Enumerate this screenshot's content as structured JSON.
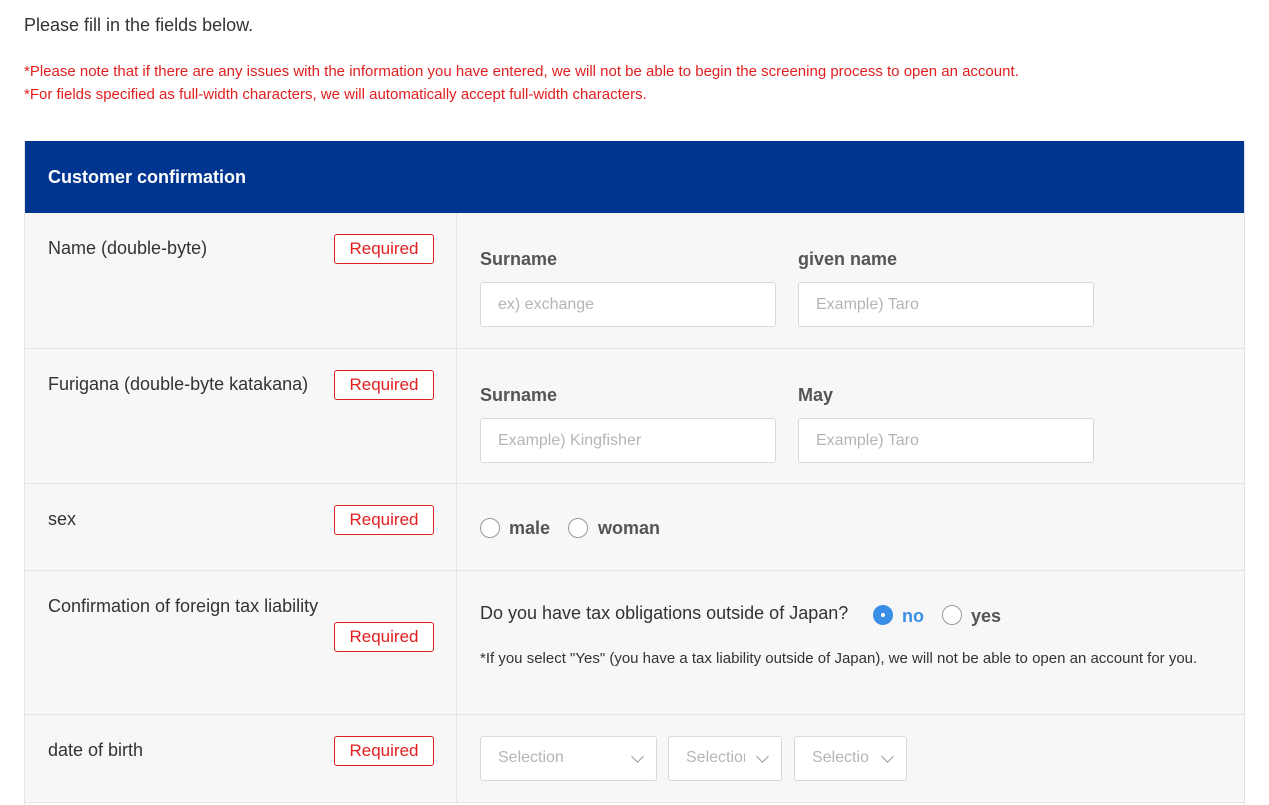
{
  "intro": "Please fill in the fields below.",
  "notes": [
    "*Please note that if there are any issues with the information you have entered, we will not be able to begin the screening process to open an account.",
    "*For fields specified as full-width characters, we will automatically accept full-width characters."
  ],
  "section_title": "Customer confirmation",
  "required_label": "Required",
  "rows": {
    "name": {
      "label": "Name (double-byte)",
      "surname_label": "Surname",
      "surname_placeholder": "ex) exchange",
      "given_label": "given name",
      "given_placeholder": "Example) Taro"
    },
    "furigana": {
      "label": "Furigana (double-byte katakana)",
      "surname_label": "Surname",
      "surname_placeholder": "Example) Kingfisher",
      "given_label": "May",
      "given_placeholder": "Example) Taro"
    },
    "sex": {
      "label": "sex",
      "options": [
        "male",
        "woman"
      ],
      "selected": null
    },
    "tax": {
      "label": "Confirmation of foreign tax liability",
      "question": "Do you have tax obligations outside of Japan?",
      "options": [
        "no",
        "yes"
      ],
      "selected": "no",
      "note": "*If you select \"Yes\" (you have a tax liability outside of Japan), we will not be able to open an account for you."
    },
    "dob": {
      "label": "date of birth",
      "selects": [
        "Selection",
        "Selection",
        "Selection"
      ]
    }
  },
  "colors": {
    "header_bg": "#003690",
    "required": "#e02020",
    "accent": "#3a8ee6"
  }
}
